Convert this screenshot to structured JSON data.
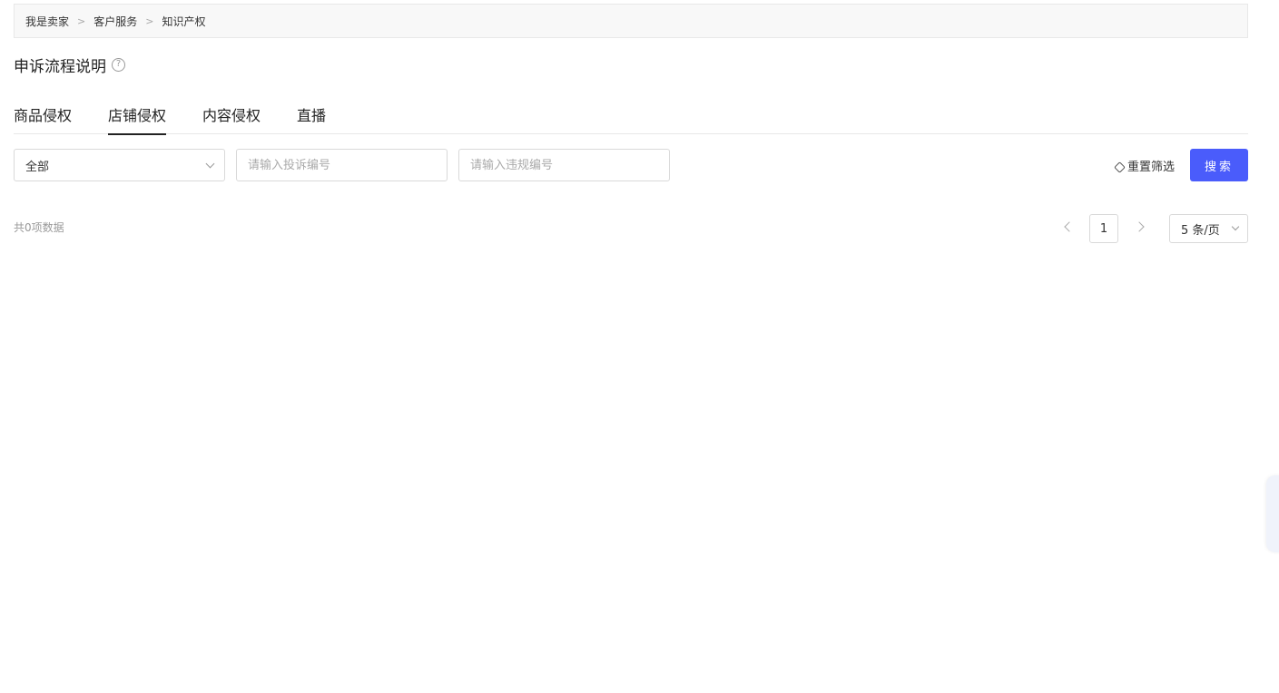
{
  "breadcrumb": {
    "items": [
      "我是卖家",
      "客户服务",
      "知识产权"
    ],
    "separator": ">"
  },
  "title": {
    "text": "申诉流程说明",
    "help_icon": "?"
  },
  "tabs": [
    {
      "label": "商品侵权",
      "active": false
    },
    {
      "label": "店铺侵权",
      "active": true
    },
    {
      "label": "内容侵权",
      "active": false
    },
    {
      "label": "直播",
      "active": false
    }
  ],
  "filters": {
    "type_select": "全部",
    "complaint_placeholder": "请输入投诉编号",
    "violation_placeholder": "请输入违规编号",
    "reset_label": "重置筛选",
    "search_label": "搜索"
  },
  "results": {
    "count_text": "共0项数据"
  },
  "pagination": {
    "current_page": "1",
    "page_size": "5 条/页"
  },
  "colors": {
    "primary": "#4a5cfb"
  }
}
